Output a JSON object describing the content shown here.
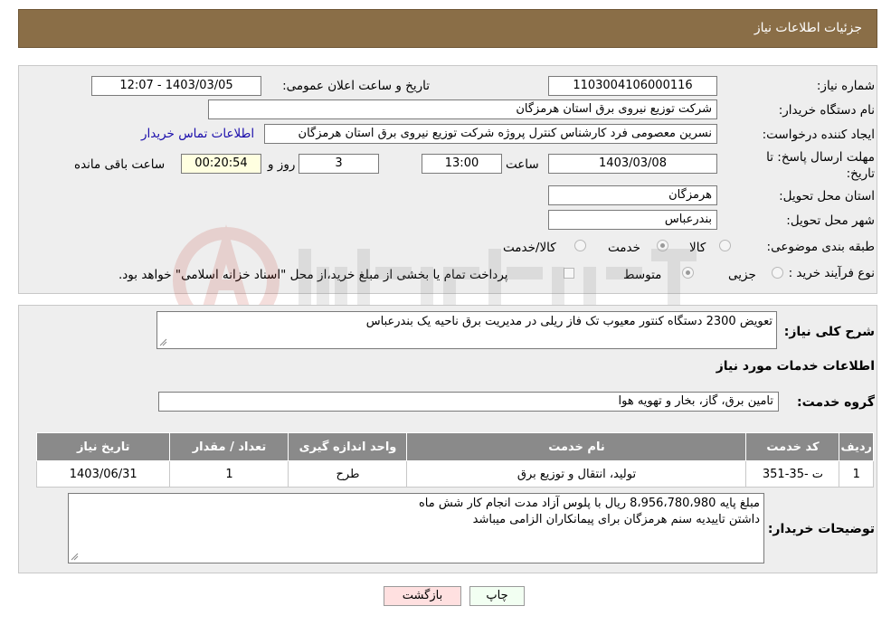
{
  "header": {
    "title": "جزئیات اطلاعات نیاز"
  },
  "form": {
    "need_number_label": "شماره نیاز:",
    "need_number": "1103004106000116",
    "announce_label": "تاریخ و ساعت اعلان عمومی:",
    "announce_value": "1403/03/05 - 12:07",
    "buyer_label": "نام دستگاه خریدار:",
    "buyer_value": "شرکت توزیع نیروی برق استان هرمزگان",
    "creator_label": "ایجاد کننده درخواست:",
    "creator_value": "نسرین معصومی فرد کارشناس کنترل پروژه شرکت توزیع نیروی برق استان هرمزگان",
    "contact_link": "اطلاعات تماس خریدار",
    "deadline_label_1": "مهلت ارسال پاسخ: تا",
    "deadline_label_2": "تاریخ:",
    "deadline_date": "1403/03/08",
    "time_label": "ساعت",
    "deadline_time": "13:00",
    "days_value": "3",
    "days_label": "روز و",
    "remaining_value": "00:20:54",
    "remaining_label": "ساعت باقی مانده",
    "province_label": "استان محل تحویل:",
    "province_value": "هرمزگان",
    "city_label": "شهر محل تحویل:",
    "city_value": "بندرعباس",
    "category_label": "طبقه بندی موضوعی:",
    "category_options": [
      "کالا",
      "خدمت",
      "کالا/خدمت"
    ],
    "category_selected": 1,
    "process_label": "نوع فرآیند خرید :",
    "process_options": [
      "جزیی",
      "متوسط"
    ],
    "process_selected": 1,
    "payment_note": "پرداخت تمام یا بخشی از مبلغ خرید،از محل \"اسناد خزانه اسلامی\" خواهد بود."
  },
  "details": {
    "summary_label": "شرح کلی نیاز:",
    "summary_value": "تعویض 2300 دستگاه کنتور معیوب تک فاز ریلی در مدیریت برق ناحیه یک بندرعباس",
    "services_title": "اطلاعات خدمات مورد نیاز",
    "group_label": "گروه خدمت:",
    "group_value": "تامین برق، گاز، بخار و تهویه هوا",
    "table": {
      "headers": [
        "ردیف",
        "کد خدمت",
        "نام خدمت",
        "واحد اندازه گیری",
        "تعداد / مقدار",
        "تاریخ نیاز"
      ],
      "rows": [
        [
          "1",
          "ت -35-351",
          "تولید، انتقال و توزیع برق",
          "طرح",
          "1",
          "1403/06/31"
        ]
      ]
    },
    "buyer_notes_label": "توضیحات خریدار:",
    "buyer_notes_line1": "مبلغ پایه 8،956،780،980 ریال با پلوس آزاد مدت انجام کار شش ماه",
    "buyer_notes_line2": "داشتن تاییدیه سنم هرمزگان برای پیمانکاران الزامی میباشد"
  },
  "buttons": {
    "print": "چاپ",
    "back": "بازگشت"
  },
  "colors": {
    "header": "#8a6e47",
    "panel": "#eeeeee",
    "table_header": "#8a8a8a",
    "back_button": "#ffe0e0"
  }
}
